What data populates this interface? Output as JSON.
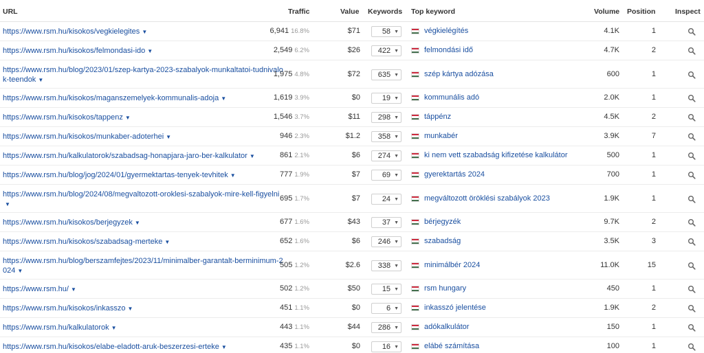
{
  "colors": {
    "link": "#1a4fa0",
    "flag_red": "#cd2a3e",
    "flag_white": "#ffffff",
    "flag_green": "#436f4d"
  },
  "headers": {
    "url": "URL",
    "traffic": "Traffic",
    "value": "Value",
    "keywords": "Keywords",
    "top_keyword": "Top keyword",
    "volume": "Volume",
    "position": "Position",
    "inspect": "Inspect"
  },
  "rows": [
    {
      "url": "https://www.rsm.hu/kisokos/vegkielegites",
      "traffic": "6,941",
      "traffic_pct": "16.8%",
      "value": "$71",
      "keywords": "58",
      "top_keyword": "végkielégítés",
      "volume": "4.1K",
      "position": "1"
    },
    {
      "url": "https://www.rsm.hu/kisokos/felmondasi-ido",
      "traffic": "2,549",
      "traffic_pct": "6.2%",
      "value": "$26",
      "keywords": "422",
      "top_keyword": "felmondási idő",
      "volume": "4.7K",
      "position": "2"
    },
    {
      "url": "https://www.rsm.hu/blog/2023/01/szep-kartya-2023-szabalyok-munkaltatoi-tudnivalok-teendok",
      "traffic": "1,975",
      "traffic_pct": "4.8%",
      "value": "$72",
      "keywords": "635",
      "top_keyword": "szép kártya adózása",
      "volume": "600",
      "position": "1"
    },
    {
      "url": "https://www.rsm.hu/kisokos/maganszemelyek-kommunalis-adoja",
      "traffic": "1,619",
      "traffic_pct": "3.9%",
      "value": "$0",
      "keywords": "19",
      "top_keyword": "kommunális adó",
      "volume": "2.0K",
      "position": "1"
    },
    {
      "url": "https://www.rsm.hu/kisokos/tappenz",
      "traffic": "1,546",
      "traffic_pct": "3.7%",
      "value": "$11",
      "keywords": "298",
      "top_keyword": "táppénz",
      "volume": "4.5K",
      "position": "2"
    },
    {
      "url": "https://www.rsm.hu/kisokos/munkaber-adoterhei",
      "traffic": "946",
      "traffic_pct": "2.3%",
      "value": "$1.2",
      "keywords": "358",
      "top_keyword": "munkabér",
      "volume": "3.9K",
      "position": "7"
    },
    {
      "url": "https://www.rsm.hu/kalkulatorok/szabadsag-honapjara-jaro-ber-kalkulator",
      "traffic": "861",
      "traffic_pct": "2.1%",
      "value": "$6",
      "keywords": "274",
      "top_keyword": "ki nem vett szabadság kifizetése kalkulátor",
      "volume": "500",
      "position": "1"
    },
    {
      "url": "https://www.rsm.hu/blog/jog/2024/01/gyermektartas-tenyek-tevhitek",
      "traffic": "777",
      "traffic_pct": "1.9%",
      "value": "$7",
      "keywords": "69",
      "top_keyword": "gyerektartás 2024",
      "volume": "700",
      "position": "1"
    },
    {
      "url": "https://www.rsm.hu/blog/2024/08/megvaltozott-oroklesi-szabalyok-mire-kell-figyelni",
      "traffic": "695",
      "traffic_pct": "1.7%",
      "value": "$7",
      "keywords": "24",
      "top_keyword": "megváltozott öröklési szabályok 2023",
      "volume": "1.9K",
      "position": "1"
    },
    {
      "url": "https://www.rsm.hu/kisokos/berjegyzek",
      "traffic": "677",
      "traffic_pct": "1.6%",
      "value": "$43",
      "keywords": "37",
      "top_keyword": "bérjegyzék",
      "volume": "9.7K",
      "position": "2"
    },
    {
      "url": "https://www.rsm.hu/kisokos/szabadsag-merteke",
      "traffic": "652",
      "traffic_pct": "1.6%",
      "value": "$6",
      "keywords": "246",
      "top_keyword": "szabadság",
      "volume": "3.5K",
      "position": "3"
    },
    {
      "url": "https://www.rsm.hu/blog/berszamfejtes/2023/11/minimalber-garantalt-berminimum-2024",
      "traffic": "505",
      "traffic_pct": "1.2%",
      "value": "$2.6",
      "keywords": "338",
      "top_keyword": "minimálbér 2024",
      "volume": "11.0K",
      "position": "15"
    },
    {
      "url": "https://www.rsm.hu/",
      "traffic": "502",
      "traffic_pct": "1.2%",
      "value": "$50",
      "keywords": "15",
      "top_keyword": "rsm hungary",
      "volume": "450",
      "position": "1"
    },
    {
      "url": "https://www.rsm.hu/kisokos/inkasszo",
      "traffic": "451",
      "traffic_pct": "1.1%",
      "value": "$0",
      "keywords": "6",
      "top_keyword": "inkasszó jelentése",
      "volume": "1.9K",
      "position": "2"
    },
    {
      "url": "https://www.rsm.hu/kalkulatorok",
      "traffic": "443",
      "traffic_pct": "1.1%",
      "value": "$44",
      "keywords": "286",
      "top_keyword": "adókalkulátor",
      "volume": "150",
      "position": "1"
    },
    {
      "url": "https://www.rsm.hu/kisokos/elabe-eladott-aruk-beszerzesi-erteke",
      "traffic": "435",
      "traffic_pct": "1.1%",
      "value": "$0",
      "keywords": "16",
      "top_keyword": "elábé számítása",
      "volume": "100",
      "position": "1"
    }
  ]
}
